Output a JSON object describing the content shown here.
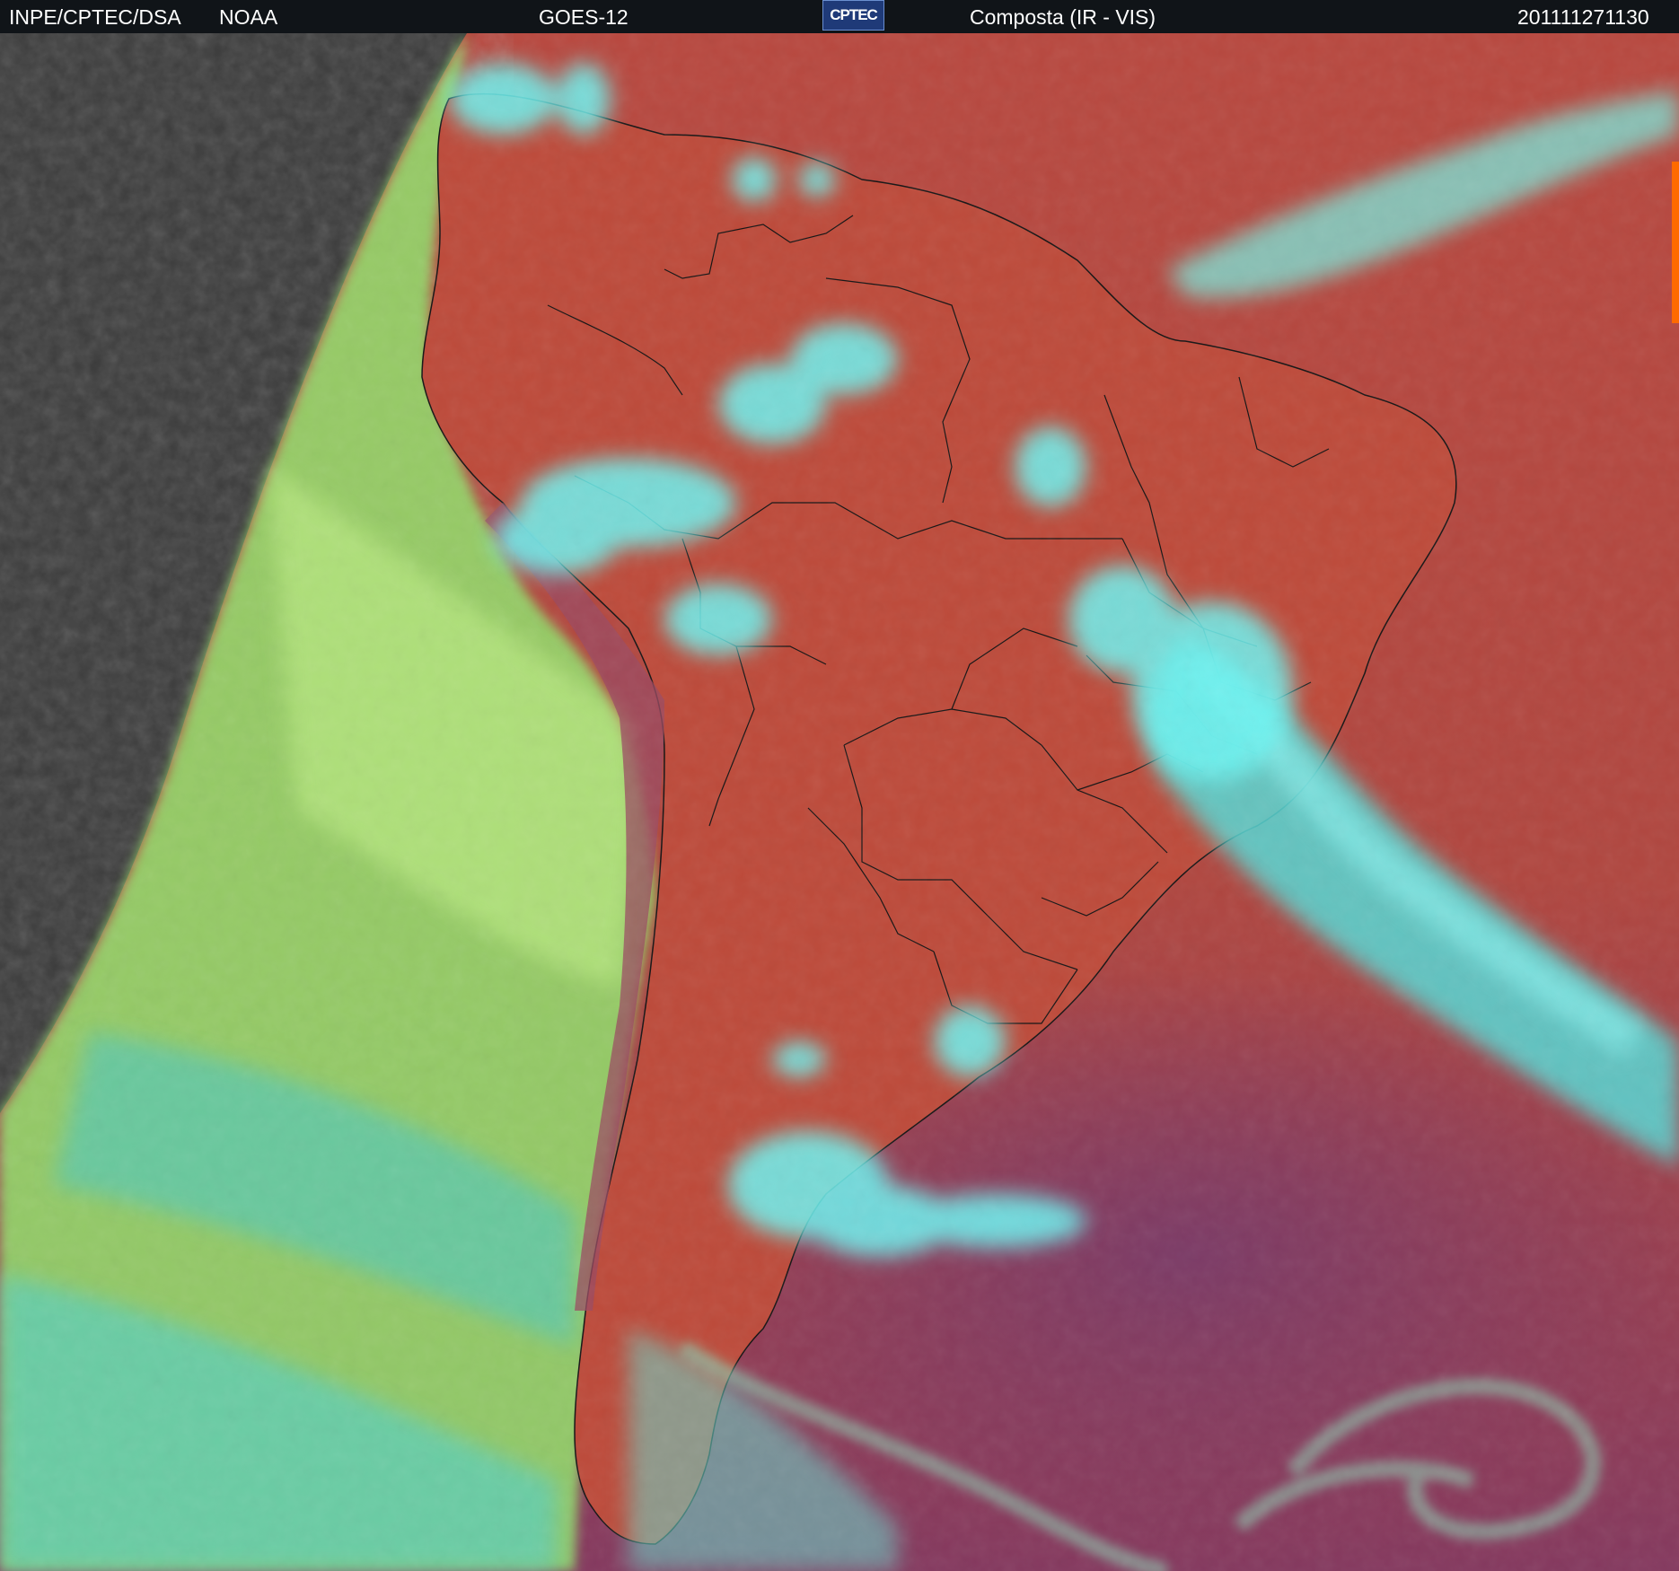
{
  "header": {
    "agency": "INPE/CPTEC/DSA",
    "partner": "NOAA",
    "satellite": "GOES-12",
    "logo_text": "CPTEC",
    "product": "Composta (IR - VIS)",
    "timestamp": "201111271130"
  },
  "colors": {
    "header_bg": "#101418",
    "night_side": "#3a3a3a",
    "terminator": "#a6e060",
    "land_warm": "#b5483e",
    "ocean_warm": "#b14a46",
    "ocean_south": "#8a3c5c",
    "low_cloud": "#8fd86c",
    "high_cloud": "#5ef0f0",
    "borders": "#101010"
  }
}
